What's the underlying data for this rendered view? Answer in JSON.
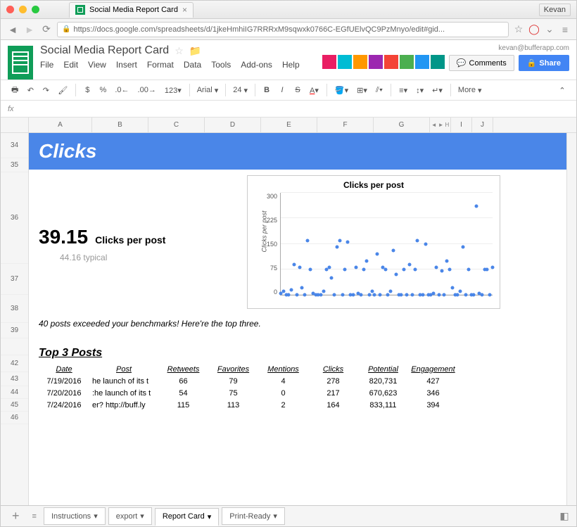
{
  "browser": {
    "tab_title": "Social Media Report Card",
    "tab_user": "Kevan",
    "url": "https://docs.google.com/spreadsheets/d/1jkeHmhiIG7RRRxM9sqwxk0766C-EGfUElvQC9PzMnyo/edit#gid..."
  },
  "doc": {
    "title": "Social Media Report Card",
    "user_email": "kevan@bufferapp.com"
  },
  "menus": [
    "File",
    "Edit",
    "View",
    "Insert",
    "Format",
    "Data",
    "Tools",
    "Add-ons",
    "Help"
  ],
  "buttons": {
    "comments": "Comments",
    "share": "Share",
    "more": "More"
  },
  "toolbar": {
    "font": "Arial",
    "size": "24"
  },
  "formula_bar": "fx",
  "columns": [
    "A",
    "B",
    "C",
    "D",
    "E",
    "F",
    "G",
    "H",
    "I",
    "J"
  ],
  "rows": [
    "34",
    "35",
    "36",
    "37",
    "38",
    "39",
    "",
    "42",
    "43",
    "44",
    "45",
    "46"
  ],
  "banner": "Clicks",
  "metric": {
    "value": "39.15",
    "label": "Clicks per post",
    "typical": "44.16 typical"
  },
  "benchmark_text": "40 posts exceeded your benchmarks! Here're the top three.",
  "top3_title": "Top 3 Posts",
  "table": {
    "headers": [
      "Date",
      "Post",
      "Retweets",
      "Favorites",
      "Mentions",
      "Clicks",
      "Potential",
      "Engagement"
    ],
    "rows": [
      [
        "7/19/2016",
        "he launch of its t",
        "66",
        "79",
        "4",
        "278",
        "820,731",
        "427"
      ],
      [
        "7/20/2016",
        ":he launch of its t",
        "54",
        "75",
        "0",
        "217",
        "670,623",
        "346"
      ],
      [
        "7/24/2016",
        "er? http://buff.ly",
        "115",
        "113",
        "2",
        "164",
        "833,111",
        "394"
      ]
    ]
  },
  "sheet_tabs": [
    "Instructions",
    "export",
    "Report Card",
    "Print-Ready"
  ],
  "chart_data": {
    "type": "scatter",
    "title": "Clicks per post",
    "ylabel": "Clicks per post",
    "ylim": [
      0,
      300
    ],
    "yticks": [
      0,
      75,
      150,
      225,
      300
    ],
    "values": [
      5,
      10,
      0,
      0,
      15,
      90,
      0,
      80,
      20,
      0,
      160,
      75,
      5,
      0,
      0,
      0,
      10,
      75,
      80,
      50,
      0,
      140,
      160,
      0,
      75,
      155,
      0,
      0,
      80,
      5,
      0,
      75,
      100,
      0,
      10,
      0,
      120,
      0,
      80,
      75,
      0,
      10,
      130,
      60,
      0,
      0,
      75,
      0,
      90,
      0,
      75,
      160,
      0,
      0,
      150,
      0,
      0,
      5,
      80,
      0,
      70,
      0,
      100,
      75,
      20,
      0,
      0,
      10,
      140,
      0,
      75,
      0,
      0,
      260,
      5,
      0,
      75,
      75,
      0,
      80
    ]
  }
}
